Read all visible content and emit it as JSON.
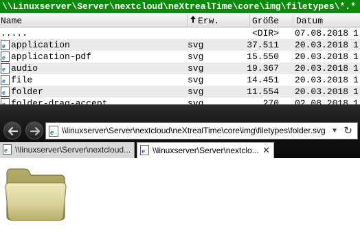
{
  "file_manager": {
    "path": "\\\\Linuxserver\\Server\\nextcloud\\neXtrealTime\\core\\img\\filetypes\\*.*",
    "columns": {
      "name": "Name",
      "ext": "Erw.",
      "size": "Größe",
      "date": "Datum",
      "sort_icon": "up-arrow-icon"
    },
    "rows": [
      {
        "name": ".....",
        "ext": "",
        "size": "<DIR>",
        "date": "07.08.2018",
        "time": "1",
        "icon": ""
      },
      {
        "name": "application",
        "ext": "svg",
        "size": "37.511",
        "date": "20.03.2018",
        "time": "1",
        "icon": "ie-file-icon"
      },
      {
        "name": "application-pdf",
        "ext": "svg",
        "size": "15.550",
        "date": "20.03.2018",
        "time": "1",
        "icon": "ie-file-icon"
      },
      {
        "name": "audio",
        "ext": "svg",
        "size": "19.367",
        "date": "20.03.2018",
        "time": "1",
        "icon": "ie-file-icon"
      },
      {
        "name": "file",
        "ext": "svg",
        "size": "14.451",
        "date": "20.03.2018",
        "time": "1",
        "icon": "ie-file-icon"
      },
      {
        "name": "folder",
        "ext": "svg",
        "size": "11.554",
        "date": "20.03.2018",
        "time": "1",
        "icon": "ie-file-icon"
      },
      {
        "name": "folder-drag-accept",
        "ext": "svg",
        "size": "270",
        "date": "02.08.2018",
        "time": "1",
        "icon": "ie-file-icon"
      }
    ]
  },
  "browser": {
    "address": "\\\\linuxserver\\Server\\nextcloud\\neXtrealTime\\core\\img\\filetypes\\folder.svg",
    "dropdown_glyph": "▼",
    "refresh_glyph": "↻",
    "tabs": [
      {
        "label": "\\\\linuxserver\\Server\\nextcloud...",
        "active": false
      },
      {
        "label": "\\\\linuxserver\\Server\\nextclo...",
        "active": true,
        "close": "✕"
      }
    ],
    "colors": {
      "path_bar": "#0b8a0b",
      "chrome_dark": "#121212",
      "folder_fill": "#d8d29a"
    }
  }
}
